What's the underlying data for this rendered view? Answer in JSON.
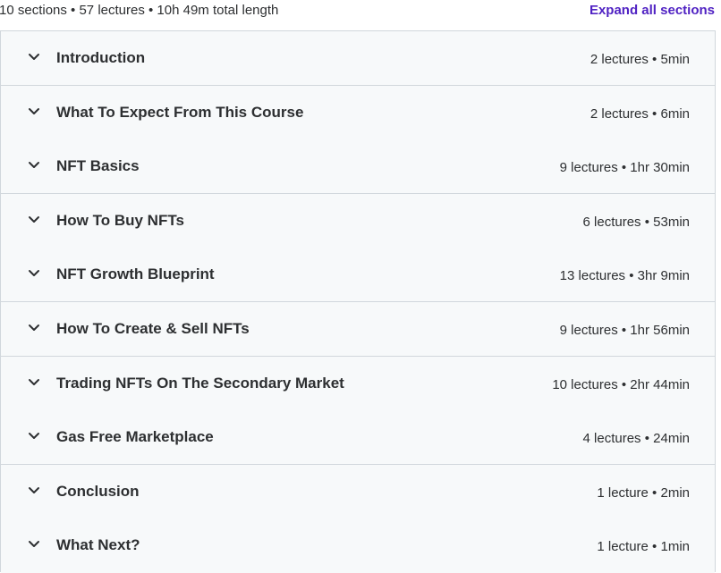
{
  "header": {
    "summary": "10 sections • 57 lectures • 10h 49m total length",
    "expand_all_label": "Expand all sections"
  },
  "colors": {
    "accent": "#5022c3",
    "text": "#2d2f31",
    "section_bg": "#f7f9fa",
    "border": "#d1d7dc"
  },
  "sections": [
    {
      "title": "Introduction",
      "meta": "2 lectures • 5min",
      "icon": "chevron-down-icon"
    },
    {
      "title": "What To Expect From This Course",
      "meta": "2 lectures • 6min",
      "icon": "chevron-down-icon"
    },
    {
      "title": "NFT Basics",
      "meta": "9 lectures • 1hr 30min",
      "icon": "chevron-down-icon"
    },
    {
      "title": "How To Buy NFTs",
      "meta": "6 lectures • 53min",
      "icon": "chevron-down-icon"
    },
    {
      "title": "NFT Growth Blueprint",
      "meta": "13 lectures • 3hr 9min",
      "icon": "chevron-down-icon"
    },
    {
      "title": "How To Create & Sell NFTs",
      "meta": "9 lectures • 1hr 56min",
      "icon": "chevron-down-icon"
    },
    {
      "title": "Trading NFTs On The Secondary Market",
      "meta": "10 lectures • 2hr 44min",
      "icon": "chevron-down-icon"
    },
    {
      "title": "Gas Free Marketplace",
      "meta": "4 lectures • 24min",
      "icon": "chevron-down-icon"
    },
    {
      "title": "Conclusion",
      "meta": "1 lecture • 2min",
      "icon": "chevron-down-icon"
    },
    {
      "title": "What Next?",
      "meta": "1 lecture • 1min",
      "icon": "chevron-down-icon"
    }
  ]
}
